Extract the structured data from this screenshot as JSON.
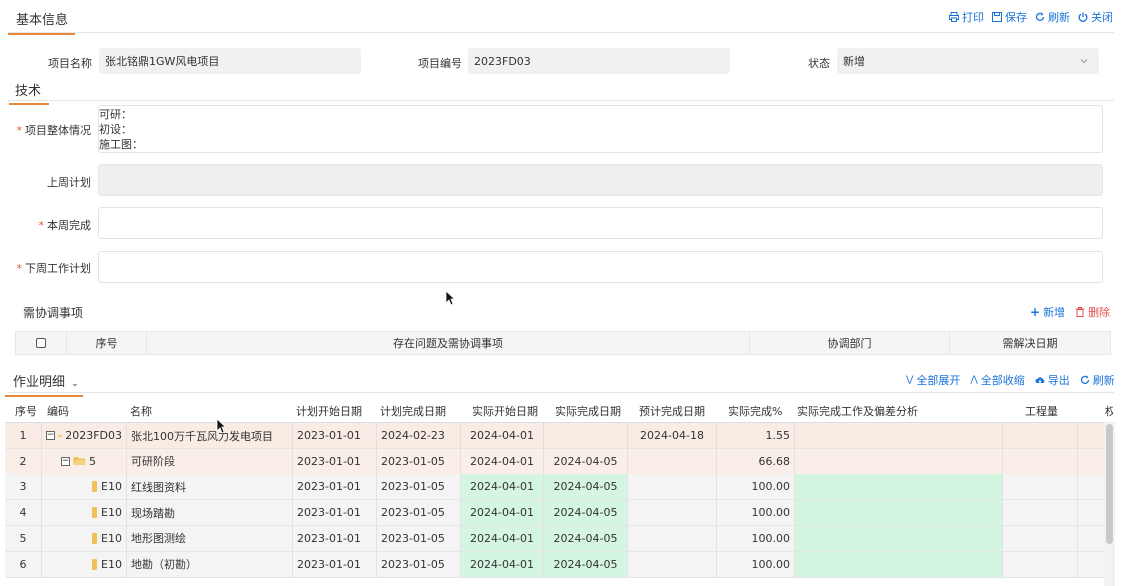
{
  "header": {
    "tab_basic": "基本信息",
    "actions": {
      "print": "打印",
      "save": "保存",
      "refresh": "刷新",
      "close": "关闭"
    }
  },
  "basic": {
    "project_name_label": "项目名称",
    "project_name_value": "张北铭鼎1GW风电项目",
    "project_code_label": "项目编号",
    "project_code_value": "2023FD03",
    "status_label": "状态",
    "status_value": "新增"
  },
  "tech": {
    "tab": "技术",
    "overall_label": "项目整体情况",
    "overall_lines": [
      "可研：",
      "初设：",
      "施工图："
    ],
    "last_week_label": "上周计划",
    "last_week_value": "",
    "this_week_label": "本周完成",
    "this_week_value": "",
    "next_week_label": "下周工作计划",
    "next_week_value": ""
  },
  "coord": {
    "title": "需协调事项",
    "add": "新增",
    "delete": "删除",
    "columns": [
      "序号",
      "存在问题及需协调事项",
      "协调部门",
      "需解决日期"
    ]
  },
  "work": {
    "tab": "作业明细",
    "actions": {
      "expand_all": "全部展开",
      "collapse_all": "全部收缩",
      "export": "导出",
      "refresh": "刷新"
    },
    "columns": [
      "序号",
      "编码",
      "名称",
      "计划开始日期",
      "计划完成日期",
      "实际开始日期",
      "实际完成日期",
      "预计完成日期",
      "实际完成%",
      "实际完成工作及偏差分析",
      "工程量",
      "权"
    ],
    "rows": [
      {
        "no": "1",
        "code": "2023FD03",
        "name": "张北100万千瓦风力发电项目",
        "plan_start": "2023-01-01",
        "plan_end": "2024-02-23",
        "act_start": "2024-04-01",
        "act_end": "",
        "est_end": "2024-04-18",
        "pct": "1.55",
        "analysis": "",
        "qty": ""
      },
      {
        "no": "2",
        "code": "5",
        "name": "可研阶段",
        "plan_start": "2023-01-01",
        "plan_end": "2023-01-05",
        "act_start": "2024-04-01",
        "act_end": "2024-04-05",
        "est_end": "",
        "pct": "66.68",
        "analysis": "",
        "qty": ""
      },
      {
        "no": "3",
        "code": "E10",
        "name": "红线图资料",
        "plan_start": "2023-01-01",
        "plan_end": "2023-01-05",
        "act_start": "2024-04-01",
        "act_end": "2024-04-05",
        "est_end": "",
        "pct": "100.00",
        "analysis": "",
        "qty": ""
      },
      {
        "no": "4",
        "code": "E10",
        "name": "现场踏勘",
        "plan_start": "2023-01-01",
        "plan_end": "2023-01-05",
        "act_start": "2024-04-01",
        "act_end": "2024-04-05",
        "est_end": "",
        "pct": "100.00",
        "analysis": "",
        "qty": ""
      },
      {
        "no": "5",
        "code": "E10",
        "name": "地形图测绘",
        "plan_start": "2023-01-01",
        "plan_end": "2023-01-05",
        "act_start": "2024-04-01",
        "act_end": "2024-04-05",
        "est_end": "",
        "pct": "100.00",
        "analysis": "",
        "qty": ""
      },
      {
        "no": "6",
        "code": "E10",
        "name": "地勘（初勘）",
        "plan_start": "2023-01-01",
        "plan_end": "2023-01-05",
        "act_start": "2024-04-01",
        "act_end": "2024-04-05",
        "est_end": "",
        "pct": "100.00",
        "analysis": "",
        "qty": ""
      }
    ]
  },
  "colors": {
    "accent": "#e8883a",
    "link": "#1a73d9",
    "danger": "#e2524a",
    "done_cell": "#d4f6e1",
    "required": "#e8503a"
  }
}
